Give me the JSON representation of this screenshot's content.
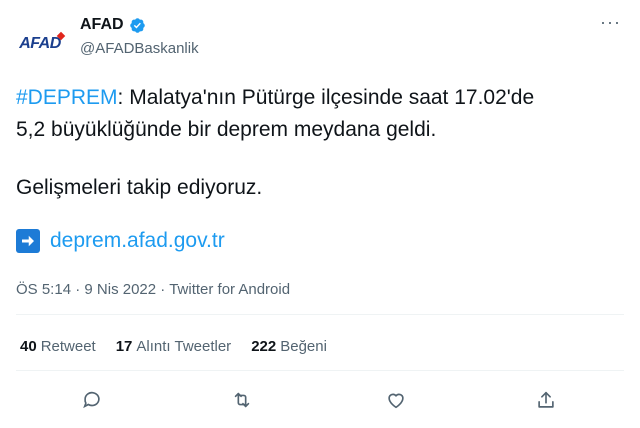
{
  "account": {
    "avatar_text": "AFAD",
    "display_name": "AFAD",
    "handle": "@AFADBaskanlik",
    "verified": true
  },
  "menu": {
    "more_icon": "more-horizontal-icon",
    "more_label": "···"
  },
  "tweet": {
    "hashtag": "#DEPREM",
    "line1_rest": ": Malatya'nın Pütürge ilçesinde saat 17.02'de",
    "line2": "5,2 büyüklüğünde bir deprem meydana geldi.",
    "line3": "Gelişmeleri takip ediyoruz.",
    "link_icon": "arrow-right-icon",
    "link_text": "deprem.afad.gov.tr"
  },
  "meta": {
    "time": "ÖS 5:14",
    "separator": "·",
    "date": "9 Nis 2022",
    "source": "Twitter for Android"
  },
  "stats": {
    "retweets_count": "40",
    "retweets_label": "Retweet",
    "quotes_count": "17",
    "quotes_label": "Alıntı Tweetler",
    "likes_count": "222",
    "likes_label": "Beğeni"
  },
  "actions": [
    "reply-icon",
    "retweet-icon",
    "like-icon",
    "share-icon"
  ],
  "colors": {
    "accent": "#1d9bf0",
    "text": "#0f1419",
    "muted": "#536471",
    "brand_blue": "#1b3f8e",
    "brand_red": "#e1261c"
  }
}
